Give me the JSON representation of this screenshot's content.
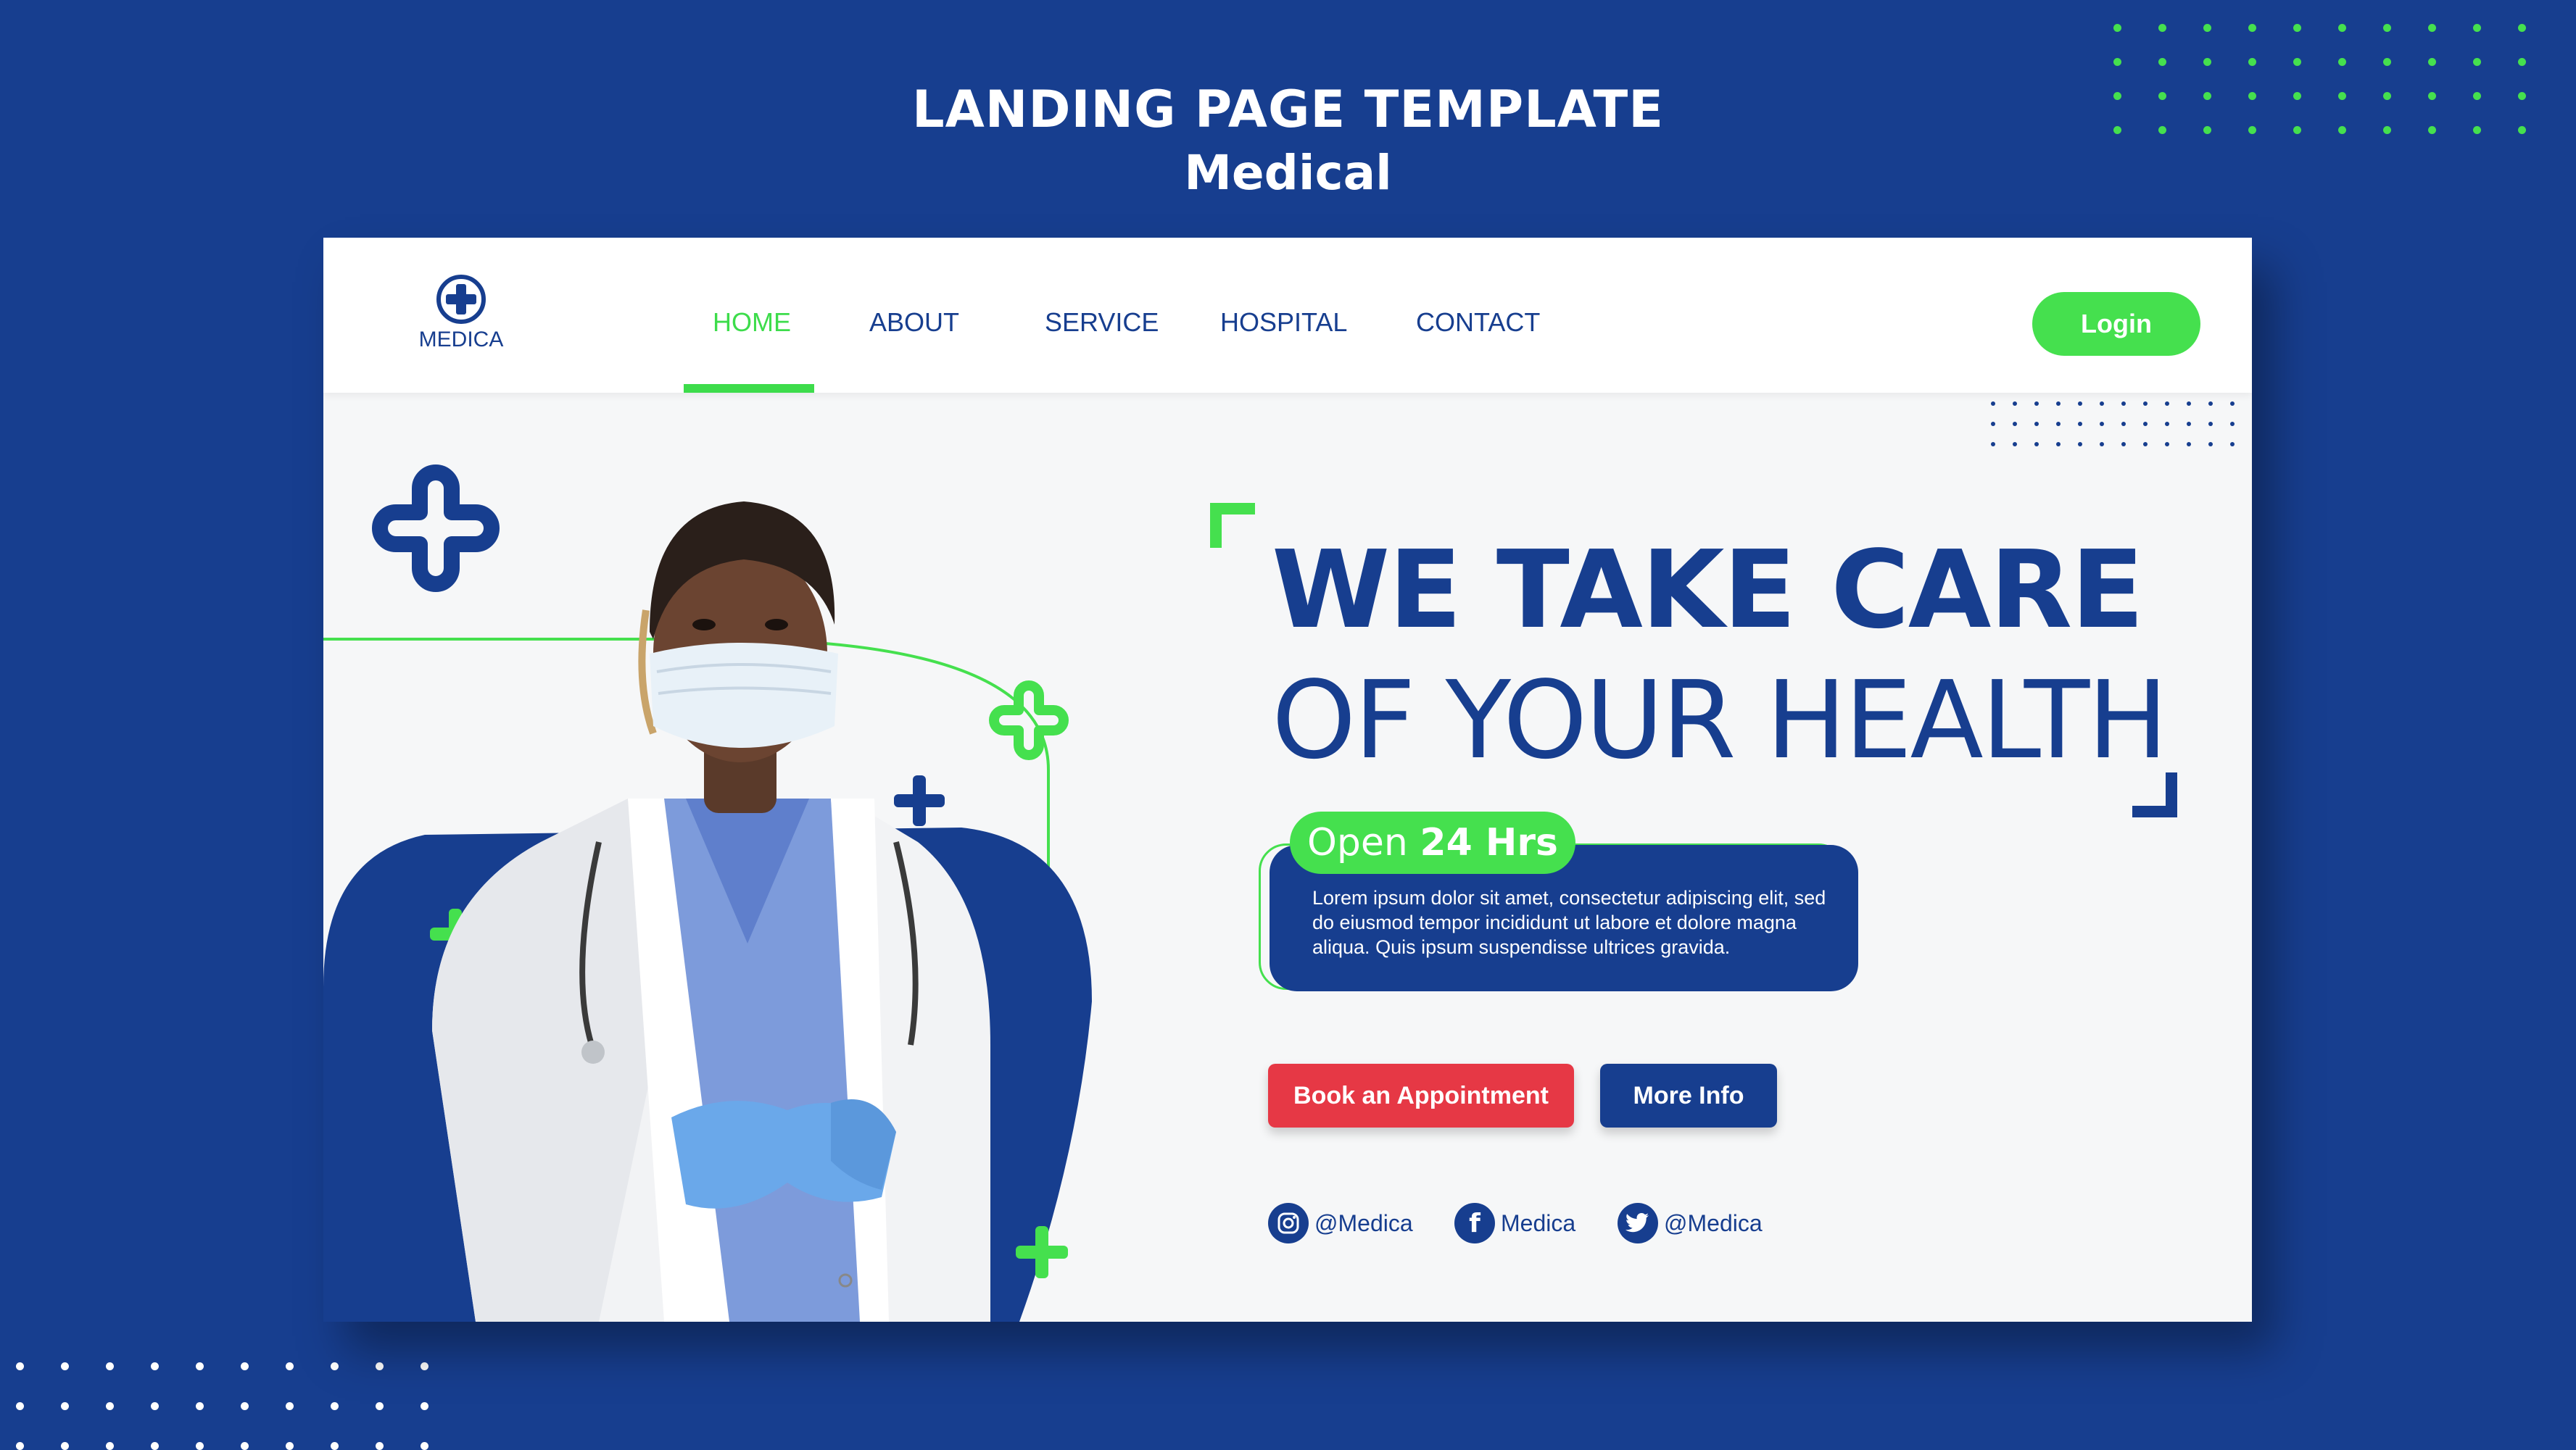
{
  "page": {
    "heading": "LANDING PAGE TEMPLATE",
    "subheading": "Medical"
  },
  "colors": {
    "background": "#173e8f",
    "primary": "#173e8f",
    "accent_green": "#45e04e",
    "cta_red": "#e63845",
    "card_bg": "#f6f7f8"
  },
  "navbar": {
    "logo_text": "MEDICA",
    "logo_icon": "medical-cross-icon",
    "items": [
      {
        "label": "HOME",
        "active": true
      },
      {
        "label": "ABOUT",
        "active": false
      },
      {
        "label": "SERVICE",
        "active": false
      },
      {
        "label": "HOSPITAL",
        "active": false
      },
      {
        "label": "CONTACT",
        "active": false
      }
    ],
    "login_label": "Login"
  },
  "hero": {
    "headline_line1": "WE TAKE CARE",
    "headline_line2": "OF YOUR HEALTH",
    "open_prefix": "Open",
    "open_hours": "24 Hrs",
    "description": "Lorem ipsum dolor sit amet, consectetur adipiscing elit, sed do eiusmod tempor incididunt ut labore et dolore magna aliqua. Quis ipsum suspendisse ultrices gravida.",
    "book_label": "Book an Appointment",
    "more_label": "More Info",
    "image": "doctor-photo"
  },
  "social": [
    {
      "icon": "instagram-icon",
      "handle": "@Medica"
    },
    {
      "icon": "facebook-icon",
      "handle": "Medica"
    },
    {
      "icon": "twitter-icon",
      "handle": "@Medica"
    }
  ]
}
